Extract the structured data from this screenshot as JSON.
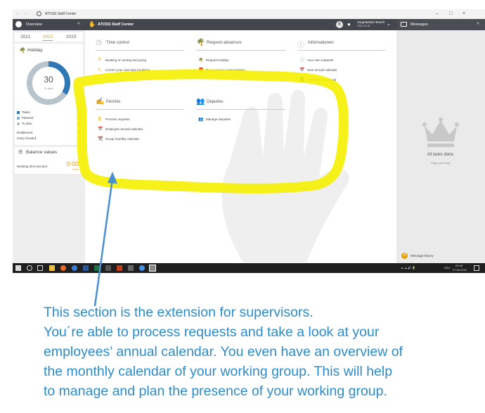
{
  "window": {
    "title": "ATOSS Staff Center",
    "controls": [
      "–",
      "□",
      "×"
    ]
  },
  "header": {
    "overview_label": "Overview",
    "app_title": "ATOSS Staff Center",
    "notification_letter": "B",
    "user_name": "Vorgesetzter Bosch",
    "user_sub": "ZSM 1% 38",
    "messages_label": "Messages"
  },
  "sidebar": {
    "years": [
      "2021",
      "2022",
      "2023"
    ],
    "selected_year": "2022",
    "holiday": {
      "title": "Holiday",
      "remaining_value": "30",
      "remaining_label": "To plan",
      "taken_fraction": 0.34,
      "legend": [
        {
          "label": "Taken",
          "value": "17",
          "color": "#2f78b5"
        },
        {
          "label": "Planned",
          "value": "0",
          "color": "#7fb3dc"
        },
        {
          "label": "To plan",
          "value": "30",
          "color": "#b8c4cc"
        }
      ],
      "entitlement_label": "Entitlement",
      "entitlement_value": "30",
      "carry_label": "Carry forward",
      "carry_value": "17"
    },
    "balance": {
      "title": "Balance values",
      "account_label": "Working time account",
      "account_value": "0:00",
      "account_unit": "hours"
    }
  },
  "main": {
    "sections": [
      {
        "title": "Time control",
        "icon": "clock-icon",
        "links": [
          "Booking of coming and going",
          "Correct your own time bookings"
        ]
      },
      {
        "title": "Request absences",
        "icon": "palm-tree-icon",
        "links": [
          "Request holiday",
          "Request time compensation"
        ]
      },
      {
        "title": "Informationen",
        "icon": "info-icon",
        "links": [
          "Your own requests",
          "Own annual calendar",
          "Own monthly journal"
        ]
      },
      {
        "title": "Permits",
        "icon": "pen-icon",
        "links": [
          "Process requests",
          "Employee annual calendar",
          "Group monthly calendar"
        ]
      },
      {
        "title": "Deputies",
        "icon": "people-icon",
        "links": [
          "Manage Deputies"
        ]
      }
    ]
  },
  "messages": {
    "all_done": "All tasks done.",
    "enjoy": "Enjoy your day!",
    "history_label": "Message history"
  },
  "taskbar": {
    "tray_text": "DEU",
    "clock_time": "09:48",
    "clock_date": "27.06.2022"
  },
  "callout": {
    "lines": [
      "This section is the extension for supervisors.",
      "You´re able to process requests and take a look at your",
      "employees’ annual calendar. You even have an overview of",
      "the monthly calendar of your working group. This will help",
      "to manage and plan the presence of your working group."
    ]
  },
  "colors": {
    "accent": "#e8a000",
    "header": "#43474d",
    "highlight": "#f5f000",
    "callout_text": "#2e8bc9",
    "arrow": "#4a8fd0"
  }
}
